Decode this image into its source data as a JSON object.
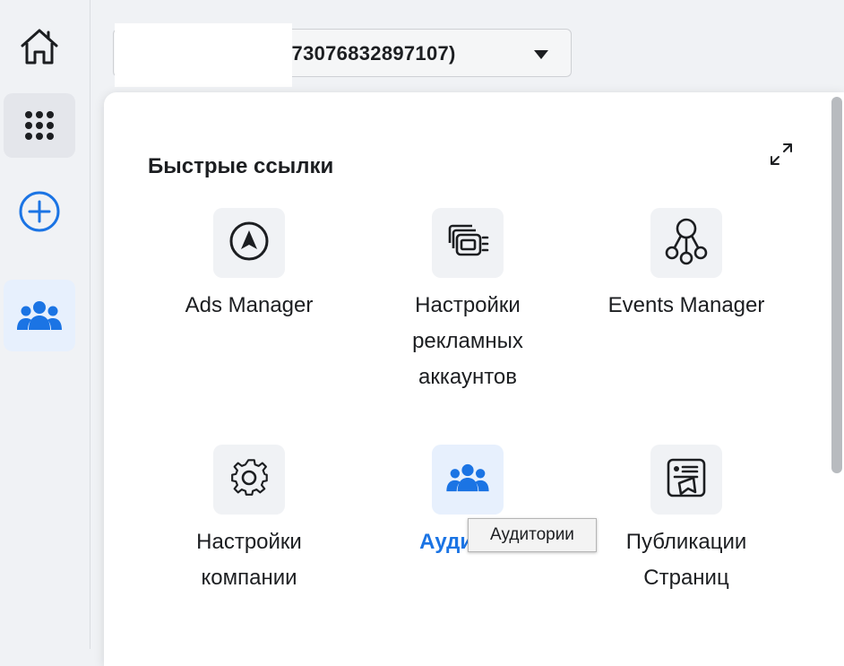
{
  "account_selector": {
    "id_fragment": "573076832897107)"
  },
  "sidebar": {
    "items": [
      {
        "icon": "home-icon"
      },
      {
        "icon": "apps-grid-icon"
      },
      {
        "icon": "add-circle-icon"
      },
      {
        "icon": "people-icon"
      }
    ]
  },
  "quick_links": {
    "title": "Быстрые ссылки",
    "tiles": [
      {
        "label": "Ads Manager",
        "icon": "navigation-arrow-icon"
      },
      {
        "label": "Настройки рекламных аккаунтов",
        "icon": "ad-accounts-icon"
      },
      {
        "label": "Events Manager",
        "icon": "events-network-icon"
      },
      {
        "label": "Настройки компании",
        "icon": "gear-icon"
      },
      {
        "label": "Аудит",
        "icon": "people-icon"
      },
      {
        "label": "Публикации Страниц",
        "icon": "page-posts-icon"
      }
    ]
  },
  "tooltip": {
    "text": "Аудитории"
  },
  "colors": {
    "accent": "#1b74e4",
    "background": "#f0f2f5",
    "panel": "#ffffff"
  }
}
